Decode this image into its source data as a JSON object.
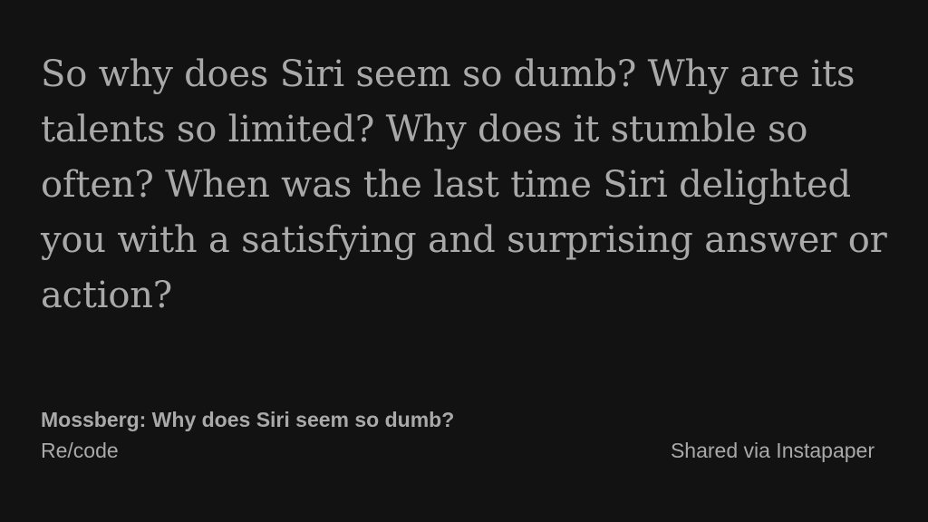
{
  "colors": {
    "background": "#121212",
    "text": "#a9a9a9"
  },
  "quote": {
    "text": "So why does Siri seem so dumb? Why are its talents so limited? Why does it stumble so often? When was the last time Siri delighted you with a satisfying and surprising answer or action?"
  },
  "article": {
    "title": "Mossberg: Why does Siri seem so dumb?",
    "source": "Re/code"
  },
  "footer": {
    "shared_label": "Shared via Instapaper"
  }
}
